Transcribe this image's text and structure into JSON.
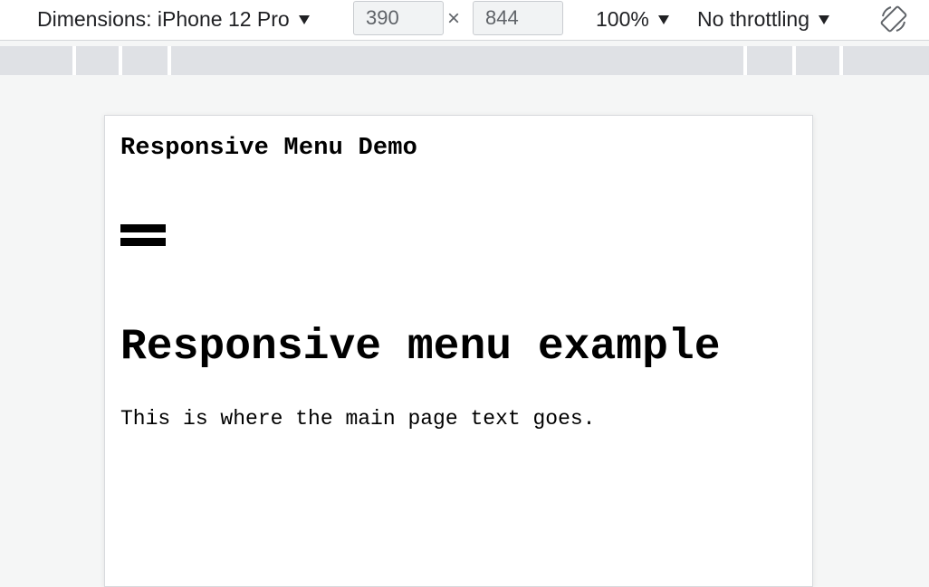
{
  "toolbar": {
    "device_label": "Dimensions: iPhone 12 Pro",
    "width_value": "390",
    "times_glyph": "×",
    "height_value": "844",
    "zoom_label": "100%",
    "throttle_label": "No throttling"
  },
  "page": {
    "site_title": "Responsive Menu Demo",
    "heading": "Responsive menu example",
    "body_text": "This is where the main page text goes."
  },
  "icons": {
    "rotate": "rotate-icon",
    "menu": "hamburger-menu-icon",
    "dropdown": "caret-down-icon"
  },
  "colors": {
    "toolbar_bg": "#ffffff",
    "ruler_bg": "#dfe1e5",
    "canvas_bg": "#f5f6f6",
    "page_bg": "#ffffff",
    "text": "#000000"
  }
}
